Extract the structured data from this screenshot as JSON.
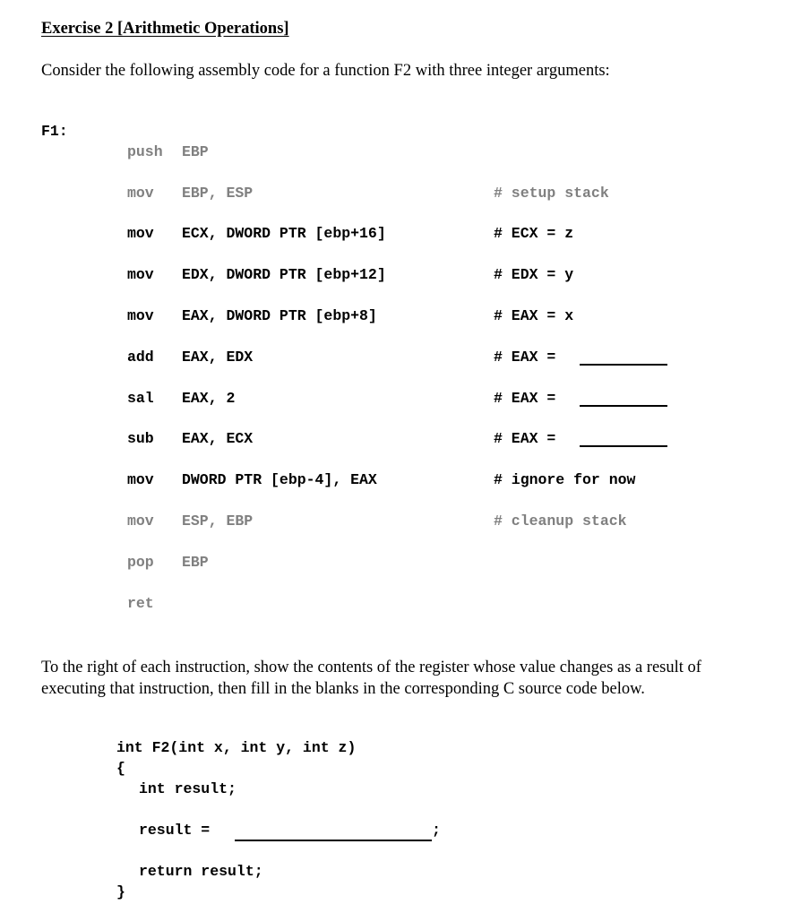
{
  "document": {
    "title": "Exercise 2 [Arithmetic Operations]",
    "intro": "Consider the following assembly code for a function F2 with three integer arguments:",
    "function_label": "F1:",
    "assembly": [
      {
        "op": "push",
        "args": "EBP",
        "comment": "",
        "dimmed": true,
        "blank": false
      },
      {
        "op": "mov",
        "args": "EBP, ESP",
        "comment": "# setup stack",
        "dimmed": true,
        "blank": false
      },
      {
        "op": "mov",
        "args": "ECX, DWORD PTR [ebp+16]",
        "comment": "# ECX = z",
        "dimmed": false,
        "blank": false
      },
      {
        "op": "mov",
        "args": "EDX, DWORD PTR [ebp+12]",
        "comment": "# EDX = y",
        "dimmed": false,
        "blank": false
      },
      {
        "op": "mov",
        "args": "EAX, DWORD PTR [ebp+8]",
        "comment": "# EAX = x",
        "dimmed": false,
        "blank": false
      },
      {
        "op": "add",
        "args": "EAX, EDX",
        "comment": "# EAX =",
        "dimmed": false,
        "blank": true
      },
      {
        "op": "sal",
        "args": "EAX, 2",
        "comment": "# EAX =",
        "dimmed": false,
        "blank": true
      },
      {
        "op": "sub",
        "args": "EAX, ECX",
        "comment": "# EAX =",
        "dimmed": false,
        "blank": true
      },
      {
        "op": "mov",
        "args": "DWORD PTR [ebp-4], EAX",
        "comment": "# ignore for now",
        "dimmed": false,
        "blank": false
      },
      {
        "op": "mov",
        "args": "ESP, EBP",
        "comment": "# cleanup stack",
        "dimmed": true,
        "blank": false
      },
      {
        "op": "pop",
        "args": "EBP",
        "comment": "",
        "dimmed": true,
        "blank": false
      },
      {
        "op": "ret",
        "args": "",
        "comment": "",
        "dimmed": true,
        "blank": false
      }
    ],
    "instructions": "To the right of each instruction, show the contents of the register whose value changes as a result of executing that instruction, then fill in the blanks in the corresponding C source code below.",
    "c_code": {
      "signature": "int F2(int x, int y, int z)",
      "open_brace": "{",
      "declaration": "int result;",
      "assignment_prefix": "result =",
      "assignment_suffix": ";",
      "return_stmt": "return result;",
      "close_brace": "}"
    },
    "colors": {
      "text": "#000000",
      "dimmed_code": "#808080",
      "background": "#ffffff"
    }
  }
}
